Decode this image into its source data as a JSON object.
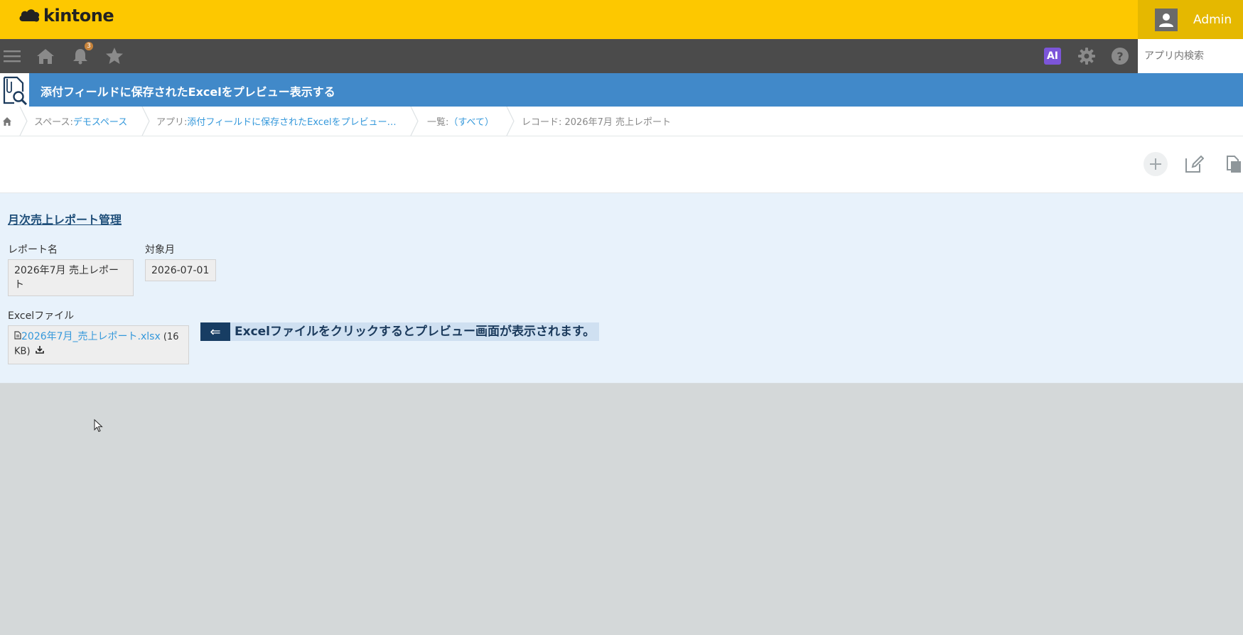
{
  "header": {
    "brand": "kintone",
    "user_name": "Admin"
  },
  "nav": {
    "notification_count": "3",
    "ai_label": "AI",
    "search_placeholder": "アプリ内検索"
  },
  "app": {
    "title": "添付フィールドに保存されたExcelをプレビュー表示する"
  },
  "breadcrumb": {
    "space_prefix": "スペース: ",
    "space_name": "デモスペース",
    "app_prefix": "アプリ: ",
    "app_name": "添付フィールドに保存されたExcelをプレビュー…",
    "list_prefix": "一覧: ",
    "list_name": "（すべて）",
    "record": "レコード: 2026年7月 売上レポート"
  },
  "record": {
    "section_title": "月次売上レポート管理",
    "report_name_label": "レポート名",
    "report_name_line1": "2026年7月 売上レポー",
    "report_name_line2": "ト",
    "month_label": "対象月",
    "month_value": "2026-07-01",
    "file_label": "Excelファイル",
    "file_name": "2026年7月_売上レポート.xlsx",
    "file_size_part1": " (16",
    "file_size_part2": "KB)",
    "hint_arrow": "⇐",
    "hint_text": "Excelファイルをクリックするとプレビュー画面が表示されます。"
  }
}
